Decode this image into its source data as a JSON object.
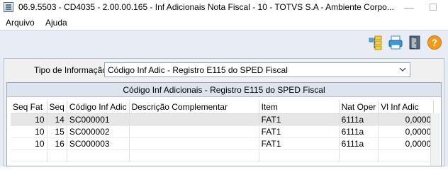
{
  "window": {
    "title": "06.9.5503 - CD4035 - 2.00.00.165 - Inf Adicionais Nota Fiscal - 10 - TOTVS S.A - Ambiente Corpo..."
  },
  "menu": {
    "arquivo": "Arquivo",
    "ajuda": "Ajuda"
  },
  "toolbar": {
    "icons": [
      "tree-icon",
      "print-icon",
      "exit-door-icon",
      "help-icon"
    ]
  },
  "form": {
    "tipo_label": "Tipo de Informação:",
    "tipo_value": "Código Inf Adic - Registro E115 do SPED Fiscal"
  },
  "grid": {
    "title": "Código Inf Adicionais - Registro E115 do SPED Fiscal",
    "columns": [
      "Seq Fat",
      "Seq",
      "Código Inf Adic",
      "Descrição Complementar",
      "Item",
      "Nat Oper",
      "Vl Inf Adic"
    ],
    "rows": [
      {
        "seq_fat": "10",
        "seq": "14",
        "codigo": "SC000001",
        "descricao": "",
        "item": "FAT1",
        "nat_oper": "6111a",
        "vl": "0,0000"
      },
      {
        "seq_fat": "10",
        "seq": "15",
        "codigo": "SC000002",
        "descricao": "",
        "item": "FAT1",
        "nat_oper": "6111a",
        "vl": "0,0000"
      },
      {
        "seq_fat": "10",
        "seq": "16",
        "codigo": "SC000003",
        "descricao": "",
        "item": "FAT1",
        "nat_oper": "6111a",
        "vl": "0,0000"
      }
    ]
  },
  "colors": {
    "toolbar_bg": "#e8edf5",
    "grid_header_bg": "#dde4ee",
    "selected_row": "#e6e6e6"
  }
}
